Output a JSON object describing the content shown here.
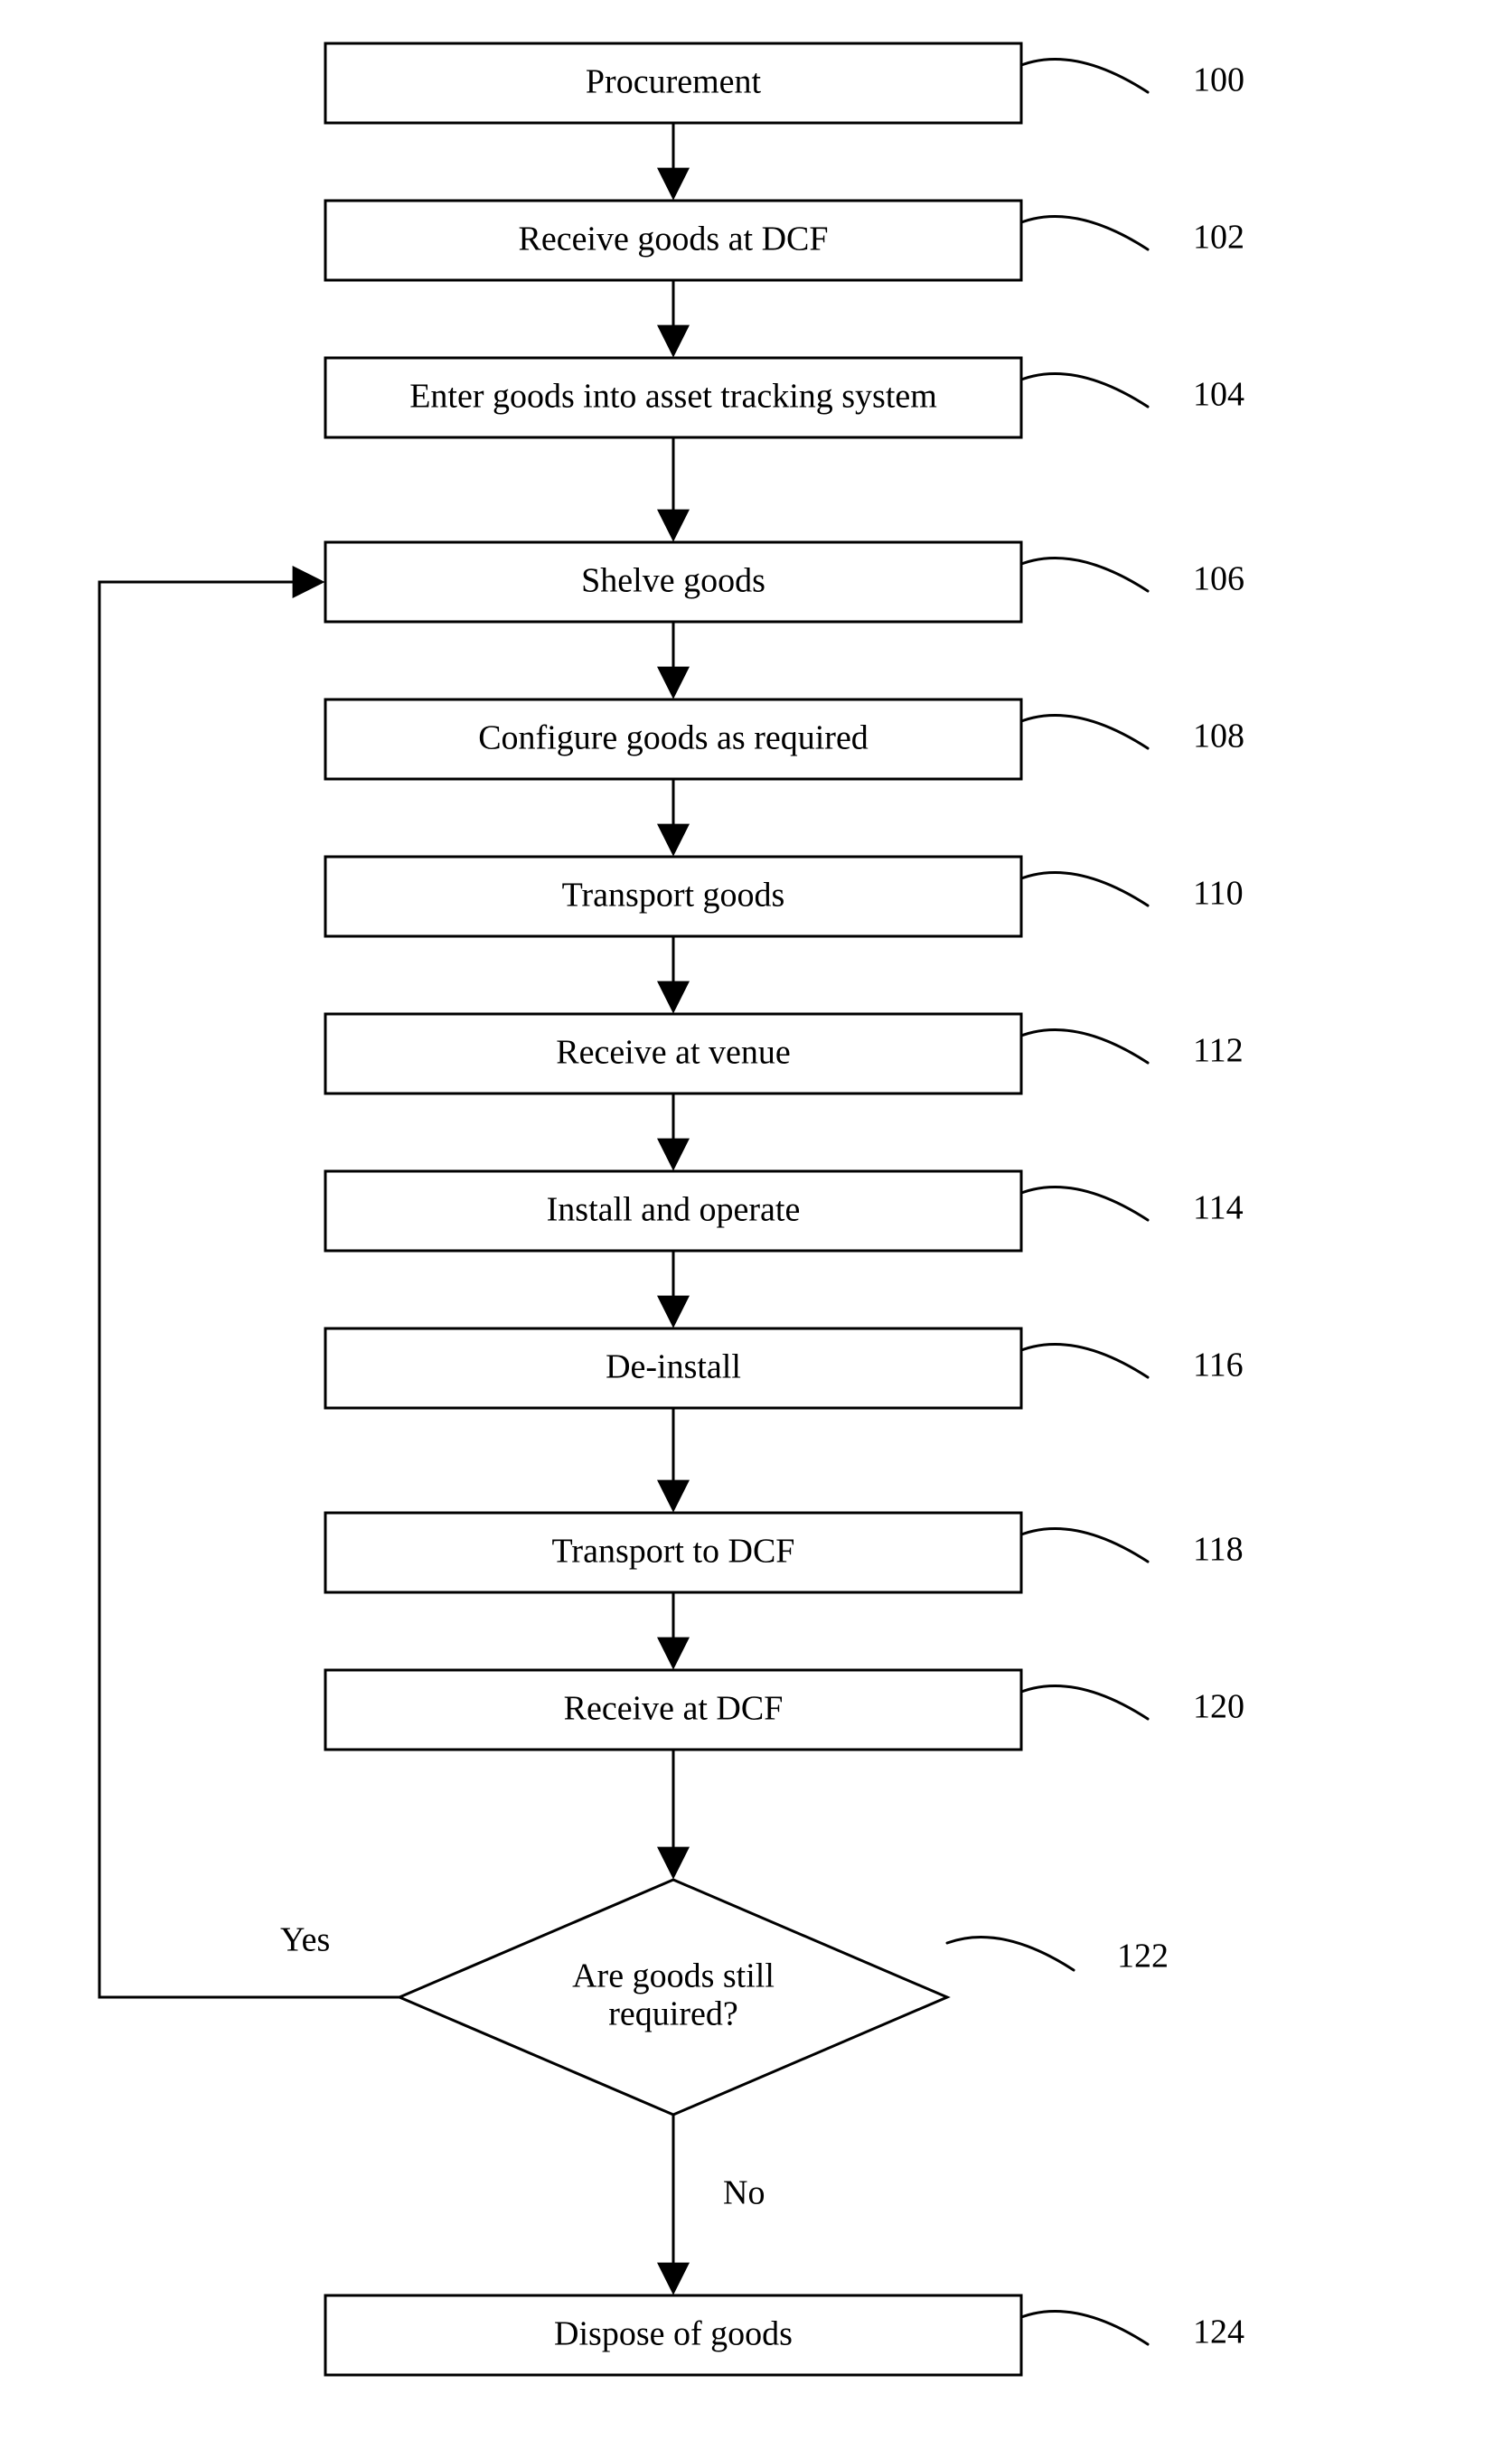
{
  "chart_data": {
    "type": "flowchart",
    "title": "",
    "nodes": [
      {
        "id": "n100",
        "ref": "100",
        "label": "Procurement",
        "shape": "rect"
      },
      {
        "id": "n102",
        "ref": "102",
        "label": "Receive goods at DCF",
        "shape": "rect"
      },
      {
        "id": "n104",
        "ref": "104",
        "label": "Enter goods into asset tracking system",
        "shape": "rect"
      },
      {
        "id": "n106",
        "ref": "106",
        "label": "Shelve goods",
        "shape": "rect"
      },
      {
        "id": "n108",
        "ref": "108",
        "label": "Configure goods as required",
        "shape": "rect"
      },
      {
        "id": "n110",
        "ref": "110",
        "label": "Transport goods",
        "shape": "rect"
      },
      {
        "id": "n112",
        "ref": "112",
        "label": "Receive at venue",
        "shape": "rect"
      },
      {
        "id": "n114",
        "ref": "114",
        "label": "Install and operate",
        "shape": "rect"
      },
      {
        "id": "n116",
        "ref": "116",
        "label": "De-install",
        "shape": "rect"
      },
      {
        "id": "n118",
        "ref": "118",
        "label": "Transport to DCF",
        "shape": "rect"
      },
      {
        "id": "n120",
        "ref": "120",
        "label": "Receive at DCF",
        "shape": "rect"
      },
      {
        "id": "n122",
        "ref": "122",
        "label_line1": "Are goods still",
        "label_line2": "required?",
        "shape": "diamond"
      },
      {
        "id": "n124",
        "ref": "124",
        "label": "Dispose of goods",
        "shape": "rect"
      }
    ],
    "edges": [
      {
        "from": "n100",
        "to": "n102"
      },
      {
        "from": "n102",
        "to": "n104"
      },
      {
        "from": "n104",
        "to": "n106"
      },
      {
        "from": "n106",
        "to": "n108"
      },
      {
        "from": "n108",
        "to": "n110"
      },
      {
        "from": "n110",
        "to": "n112"
      },
      {
        "from": "n112",
        "to": "n114"
      },
      {
        "from": "n114",
        "to": "n116"
      },
      {
        "from": "n116",
        "to": "n118"
      },
      {
        "from": "n118",
        "to": "n120"
      },
      {
        "from": "n120",
        "to": "n122"
      },
      {
        "from": "n122",
        "to": "n124",
        "label": "No"
      },
      {
        "from": "n122",
        "to": "n106",
        "label": "Yes"
      }
    ],
    "labels": {
      "yes": "Yes",
      "no": "No"
    }
  }
}
